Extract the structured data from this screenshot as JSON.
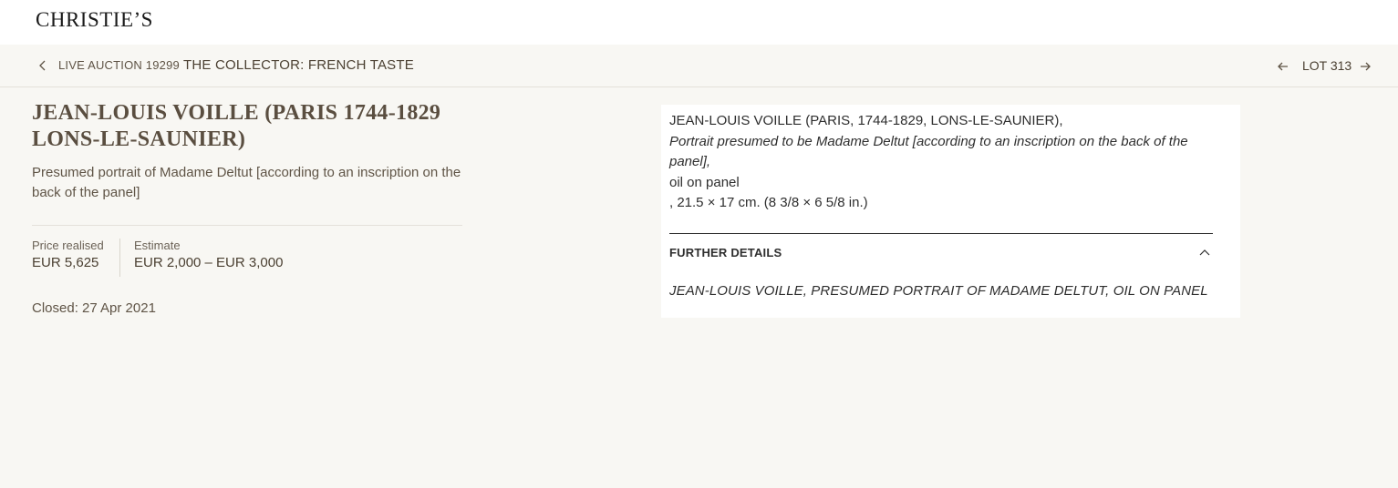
{
  "header": {
    "logo": "CHRISTIE’S"
  },
  "breadcrumb": {
    "sale": "LIVE AUCTION 19299",
    "title": "THE COLLECTOR: FRENCH TASTE",
    "lot": "LOT 313"
  },
  "lot": {
    "artist_line1": "JEAN-LOUIS VOILLE (PARIS 1744-1829",
    "artist_line2": "LONS-LE-SAUNIER)",
    "subtitle": "Presumed portrait of Madame Deltut [according to an inscription on the back of the panel]",
    "price_realised_label": "Price realised",
    "price_realised_value": "EUR 5,625",
    "estimate_label": "Estimate",
    "estimate_value": "EUR 2,000 – EUR 3,000",
    "closed": "Closed: 27 Apr 2021"
  },
  "details": {
    "line1": "JEAN-LOUIS VOILLE (PARIS, 1744-1829, LONS-LE-SAUNIER),",
    "line2": "Portrait presumed to be Madame Deltut [according to an inscription on the back of the panel],",
    "line3": "oil on panel",
    "line4": ", 21.5 × 17 cm. (8 3/8 × 6 5/8 in.)",
    "further_label": "FURTHER DETAILS",
    "further_text": "JEAN-LOUIS VOILLE, PRESUMED PORTRAIT OF MADAME DELTUT, OIL ON PANEL"
  },
  "icons": {
    "back": "chevron-left-icon",
    "prev": "arrow-left-icon",
    "next": "arrow-right-icon",
    "collapse": "chevron-up-icon"
  },
  "colors": {
    "background": "#f8f7f3",
    "accent_text": "#5a4e40",
    "card": "#ffffff"
  }
}
